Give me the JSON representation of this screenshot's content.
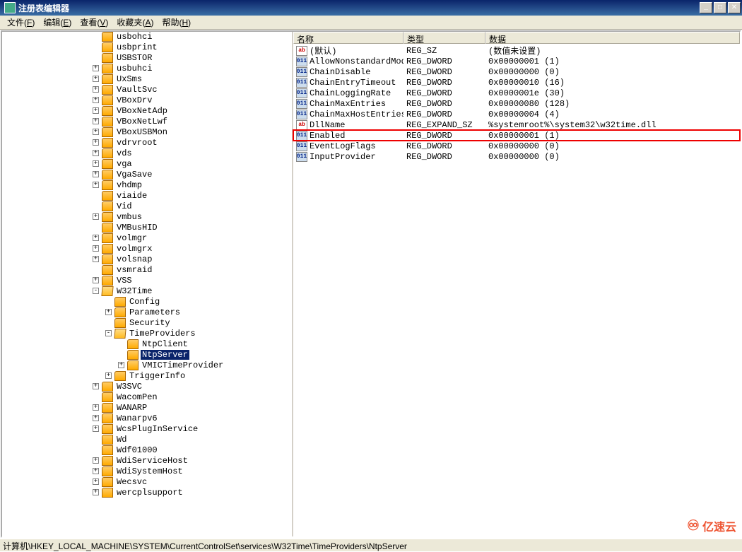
{
  "title_bar": {
    "title": "注册表编辑器"
  },
  "window_controls": {
    "min": "_",
    "max": "□",
    "close": "✕"
  },
  "menu": {
    "file": {
      "label": "文件",
      "key": "F"
    },
    "edit": {
      "label": "编辑",
      "key": "E"
    },
    "view": {
      "label": "查看",
      "key": "V"
    },
    "fav": {
      "label": "收藏夹",
      "key": "A"
    },
    "help": {
      "label": "帮助",
      "key": "H"
    }
  },
  "tree": {
    "items": [
      {
        "label": "usbohci",
        "indent": 3,
        "toggle": null
      },
      {
        "label": "usbprint",
        "indent": 3,
        "toggle": null
      },
      {
        "label": "USBSTOR",
        "indent": 3,
        "toggle": null
      },
      {
        "label": "usbuhci",
        "indent": 3,
        "toggle": "+"
      },
      {
        "label": "UxSms",
        "indent": 3,
        "toggle": "+"
      },
      {
        "label": "VaultSvc",
        "indent": 3,
        "toggle": "+"
      },
      {
        "label": "VBoxDrv",
        "indent": 3,
        "toggle": "+"
      },
      {
        "label": "VBoxNetAdp",
        "indent": 3,
        "toggle": "+"
      },
      {
        "label": "VBoxNetLwf",
        "indent": 3,
        "toggle": "+"
      },
      {
        "label": "VBoxUSBMon",
        "indent": 3,
        "toggle": "+"
      },
      {
        "label": "vdrvroot",
        "indent": 3,
        "toggle": "+"
      },
      {
        "label": "vds",
        "indent": 3,
        "toggle": "+"
      },
      {
        "label": "vga",
        "indent": 3,
        "toggle": "+"
      },
      {
        "label": "VgaSave",
        "indent": 3,
        "toggle": "+"
      },
      {
        "label": "vhdmp",
        "indent": 3,
        "toggle": "+"
      },
      {
        "label": "viaide",
        "indent": 3,
        "toggle": null
      },
      {
        "label": "Vid",
        "indent": 3,
        "toggle": null
      },
      {
        "label": "vmbus",
        "indent": 3,
        "toggle": "+"
      },
      {
        "label": "VMBusHID",
        "indent": 3,
        "toggle": null
      },
      {
        "label": "volmgr",
        "indent": 3,
        "toggle": "+"
      },
      {
        "label": "volmgrx",
        "indent": 3,
        "toggle": "+"
      },
      {
        "label": "volsnap",
        "indent": 3,
        "toggle": "+"
      },
      {
        "label": "vsmraid",
        "indent": 3,
        "toggle": null
      },
      {
        "label": "VSS",
        "indent": 3,
        "toggle": "+"
      },
      {
        "label": "W32Time",
        "indent": 3,
        "toggle": "-",
        "open": true
      },
      {
        "label": "Config",
        "indent": 4,
        "toggle": null
      },
      {
        "label": "Parameters",
        "indent": 4,
        "toggle": "+"
      },
      {
        "label": "Security",
        "indent": 4,
        "toggle": null
      },
      {
        "label": "TimeProviders",
        "indent": 4,
        "toggle": "-",
        "open": true
      },
      {
        "label": "NtpClient",
        "indent": 5,
        "toggle": null
      },
      {
        "label": "NtpServer",
        "indent": 5,
        "toggle": null,
        "selected": true
      },
      {
        "label": "VMICTimeProvider",
        "indent": 5,
        "toggle": "+"
      },
      {
        "label": "TriggerInfo",
        "indent": 4,
        "toggle": "+"
      },
      {
        "label": "W3SVC",
        "indent": 3,
        "toggle": "+"
      },
      {
        "label": "WacomPen",
        "indent": 3,
        "toggle": null
      },
      {
        "label": "WANARP",
        "indent": 3,
        "toggle": "+"
      },
      {
        "label": "Wanarpv6",
        "indent": 3,
        "toggle": "+"
      },
      {
        "label": "WcsPlugInService",
        "indent": 3,
        "toggle": "+"
      },
      {
        "label": "Wd",
        "indent": 3,
        "toggle": null
      },
      {
        "label": "Wdf01000",
        "indent": 3,
        "toggle": null
      },
      {
        "label": "WdiServiceHost",
        "indent": 3,
        "toggle": "+"
      },
      {
        "label": "WdiSystemHost",
        "indent": 3,
        "toggle": "+"
      },
      {
        "label": "Wecsvc",
        "indent": 3,
        "toggle": "+"
      },
      {
        "label": "wercplsupport",
        "indent": 3,
        "toggle": "+"
      }
    ]
  },
  "columns": {
    "name": "名称",
    "type": "类型",
    "data": "数据"
  },
  "values": [
    {
      "icon": "sz",
      "name": "(默认)",
      "type": "REG_SZ",
      "data": "(数值未设置)"
    },
    {
      "icon": "dw",
      "name": "AllowNonstandardMod...",
      "type": "REG_DWORD",
      "data": "0x00000001 (1)"
    },
    {
      "icon": "dw",
      "name": "ChainDisable",
      "type": "REG_DWORD",
      "data": "0x00000000 (0)"
    },
    {
      "icon": "dw",
      "name": "ChainEntryTimeout",
      "type": "REG_DWORD",
      "data": "0x00000010 (16)"
    },
    {
      "icon": "dw",
      "name": "ChainLoggingRate",
      "type": "REG_DWORD",
      "data": "0x0000001e (30)"
    },
    {
      "icon": "dw",
      "name": "ChainMaxEntries",
      "type": "REG_DWORD",
      "data": "0x00000080 (128)"
    },
    {
      "icon": "dw",
      "name": "ChainMaxHostEntries",
      "type": "REG_DWORD",
      "data": "0x00000004 (4)"
    },
    {
      "icon": "sz",
      "name": "DllName",
      "type": "REG_EXPAND_SZ",
      "data": "%systemroot%\\system32\\w32time.dll"
    },
    {
      "icon": "dw",
      "name": "Enabled",
      "type": "REG_DWORD",
      "data": "0x00000001 (1)",
      "highlight": true
    },
    {
      "icon": "dw",
      "name": "EventLogFlags",
      "type": "REG_DWORD",
      "data": "0x00000000 (0)"
    },
    {
      "icon": "dw",
      "name": "InputProvider",
      "type": "REG_DWORD",
      "data": "0x00000000 (0)"
    }
  ],
  "status": {
    "path": "计算机\\HKEY_LOCAL_MACHINE\\SYSTEM\\CurrentControlSet\\services\\W32Time\\TimeProviders\\NtpServer"
  },
  "watermark": {
    "text": "亿速云"
  }
}
